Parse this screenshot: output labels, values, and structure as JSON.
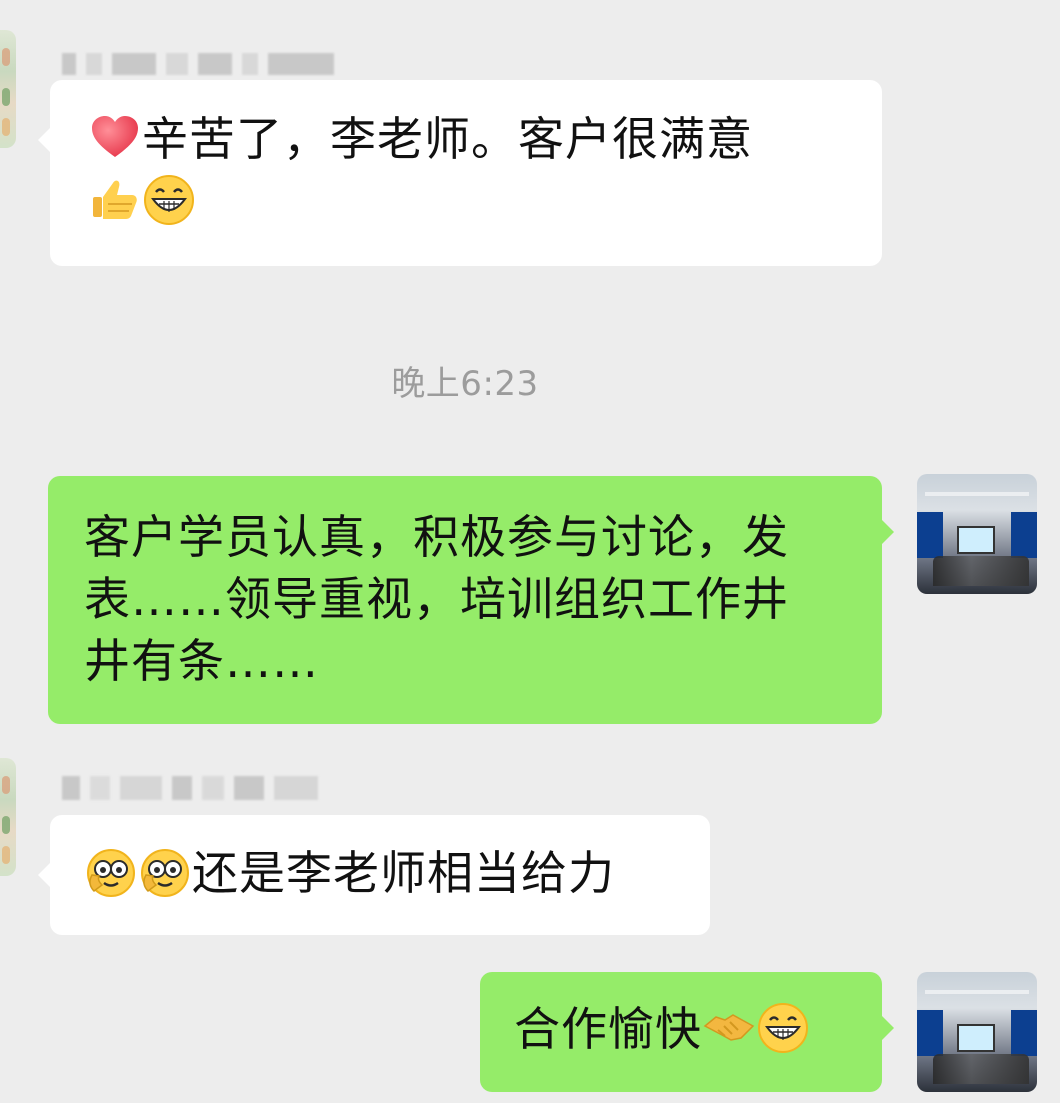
{
  "messages": [
    {
      "type": "incoming",
      "text": "辛苦了，李老师。客户很满意",
      "emojis_leading": [
        "heart-icon"
      ],
      "emojis_trailing": [
        "thumbs-up-icon",
        "grin-face-icon"
      ]
    },
    {
      "type": "timestamp",
      "text": "晚上6:23"
    },
    {
      "type": "outgoing",
      "line1": "客户学员认真，积极参与讨论，发",
      "line2": "表……领导重视，培训组织工作井",
      "line3": "井有条……"
    },
    {
      "type": "incoming",
      "text": "还是李老师相当给力",
      "emojis_leading": [
        "salute-face-icon",
        "salute-face-icon"
      ]
    },
    {
      "type": "outgoing",
      "text": "合作愉快",
      "emojis_trailing": [
        "handshake-icon",
        "grin-face-icon"
      ]
    }
  ],
  "colors": {
    "background": "#ededed",
    "incoming_bubble": "#ffffff",
    "outgoing_bubble": "#95ec69",
    "timestamp_text": "#9c9c9c"
  }
}
